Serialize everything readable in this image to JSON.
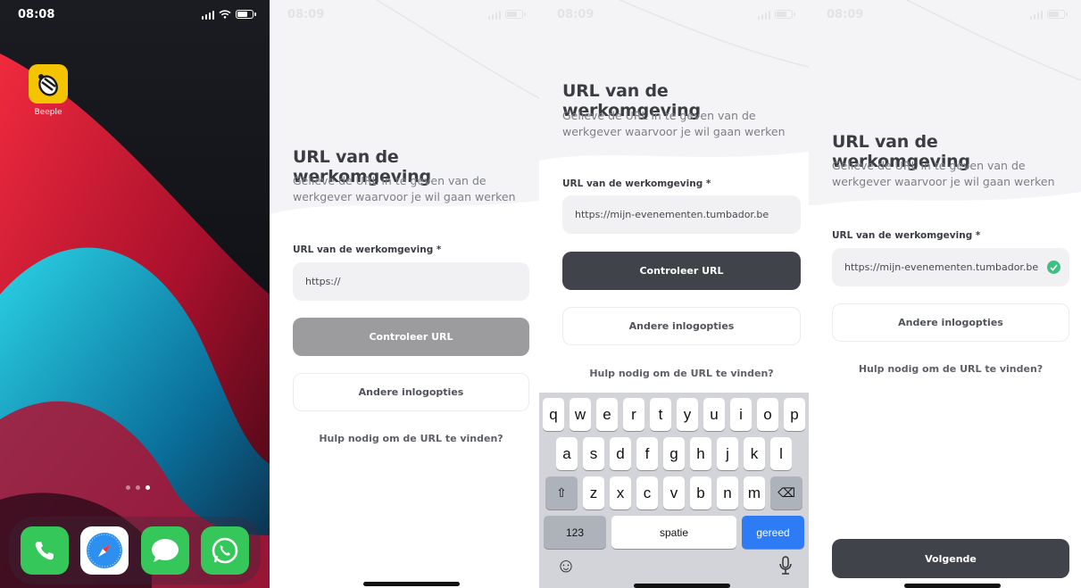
{
  "home": {
    "time": "08:08",
    "app_name": "Beeple",
    "dock_apps": [
      "phone-icon",
      "safari-icon",
      "messages-icon",
      "whatsapp-icon"
    ]
  },
  "screen2": {
    "time": "08:09",
    "title": "URL van de werkomgeving",
    "subtitle": "Gelieve de URL in te geven van de werkgever waarvoor je wil gaan werken",
    "field_label": "URL van de werkomgeving *",
    "field_value": "https://",
    "check_button": "Controleer URL",
    "other_button": "Andere inlogopties",
    "help_link": "Hulp nodig om de URL te vinden?"
  },
  "screen3": {
    "time": "08:09",
    "title": "URL van de werkomgeving",
    "subtitle": "Gelieve de URL in te geven van de werkgever waarvoor je wil gaan werken",
    "field_label": "URL van de werkomgeving *",
    "field_value": "https://mijn-evenementen.tumbador.be",
    "check_button": "Controleer URL",
    "other_button": "Andere inlogopties",
    "help_link": "Hulp nodig om de URL te vinden?",
    "keyboard": {
      "row1": [
        "q",
        "w",
        "e",
        "r",
        "t",
        "y",
        "u",
        "i",
        "o",
        "p"
      ],
      "row2": [
        "a",
        "s",
        "d",
        "f",
        "g",
        "h",
        "j",
        "k",
        "l"
      ],
      "row3": [
        "z",
        "x",
        "c",
        "v",
        "b",
        "n",
        "m"
      ],
      "numbers_key": "123",
      "space_key": "spatie",
      "done_key": "gereed",
      "shift_icon": "⇧",
      "delete_icon": "⌫",
      "emoji_icon": "☺",
      "mic_icon": "🎙"
    }
  },
  "screen4": {
    "time": "08:09",
    "title": "URL van de werkomgeving",
    "subtitle": "Gelieve de URL in te geven van de werkgever waarvoor je wil gaan werken",
    "field_label": "URL van de werkomgeving *",
    "field_value": "https://mijn-evenementen.tumbador.be",
    "other_button": "Andere inlogopties",
    "help_link": "Hulp nodig om de URL te vinden?",
    "next_button": "Volgende"
  },
  "colors": {
    "primary_button": "#41434a",
    "disabled_button": "#9c9c9e",
    "success": "#3fbf84",
    "keyboard_done": "#2d7cf6",
    "app_icon": "#f5c400"
  }
}
